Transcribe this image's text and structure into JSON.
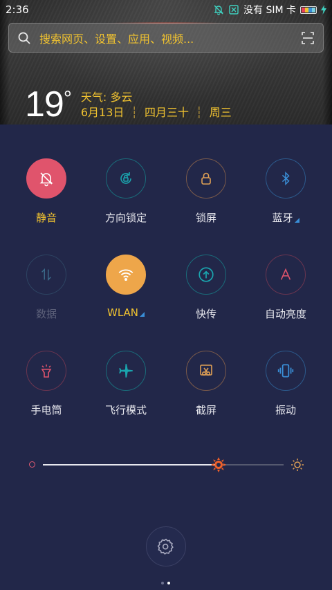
{
  "status_bar": {
    "time": "2:36",
    "carrier": "没有 SIM 卡",
    "battery_colors": [
      "#e7445a",
      "#f0c230",
      "#3a8fd8",
      "#7ad0e0"
    ],
    "charging_color": "#3fd1c0"
  },
  "search": {
    "placeholder": "搜索网页、设置、应用、视频...",
    "icon": "search-icon",
    "scan_icon": "scan-icon"
  },
  "weather": {
    "temperature": "19",
    "degree": "°",
    "condition": "天气: 多云",
    "date": "6月13日",
    "lunar": "四月三十",
    "weekday": "周三"
  },
  "toggles": [
    {
      "label": "静音",
      "icon": "bell-off-icon",
      "active": true,
      "accent": "#e0546c",
      "fill": "#e0546c",
      "has_corner": false
    },
    {
      "label": "方向锁定",
      "icon": "rotation-lock-icon",
      "active": false,
      "accent": "#1aa5ae",
      "fill": "none",
      "has_corner": false
    },
    {
      "label": "锁屏",
      "icon": "lock-icon",
      "active": false,
      "accent": "#e0a055",
      "fill": "none",
      "has_corner": false
    },
    {
      "label": "蓝牙",
      "icon": "bluetooth-icon",
      "active": false,
      "accent": "#3a8fd8",
      "fill": "none",
      "has_corner": true
    },
    {
      "label": "数据",
      "icon": "data-icon",
      "active": false,
      "accent": "#3b6a8a",
      "fill": "none",
      "has_corner": false,
      "dim": true
    },
    {
      "label": "WLAN",
      "icon": "wifi-icon",
      "active": true,
      "accent": "#eea64a",
      "fill": "#eea64a",
      "has_corner": true,
      "label_color": "#f0c230"
    },
    {
      "label": "快传",
      "icon": "transfer-icon",
      "active": false,
      "accent": "#1aa5ae",
      "fill": "none",
      "has_corner": false
    },
    {
      "label": "自动亮度",
      "icon": "auto-brightness-icon",
      "active": false,
      "accent": "#e0546c",
      "fill": "none",
      "has_corner": false
    },
    {
      "label": "手电筒",
      "icon": "flashlight-icon",
      "active": false,
      "accent": "#e0546c",
      "fill": "none",
      "has_corner": false
    },
    {
      "label": "飞行模式",
      "icon": "airplane-icon",
      "active": false,
      "accent": "#1aa5ae",
      "fill": "none",
      "has_corner": false
    },
    {
      "label": "截屏",
      "icon": "screenshot-icon",
      "active": false,
      "accent": "#e0a055",
      "fill": "none",
      "has_corner": false
    },
    {
      "label": "振动",
      "icon": "vibrate-icon",
      "active": false,
      "accent": "#3a8fd8",
      "fill": "none",
      "has_corner": false
    }
  ],
  "brightness": {
    "level": 0.73,
    "min_icon": "brightness-low-icon",
    "max_icon": "brightness-high-icon",
    "thumb_color": "#f0612a"
  },
  "settings": {
    "icon": "gear-icon"
  },
  "page_indicator": {
    "count": 2,
    "active": 1
  }
}
